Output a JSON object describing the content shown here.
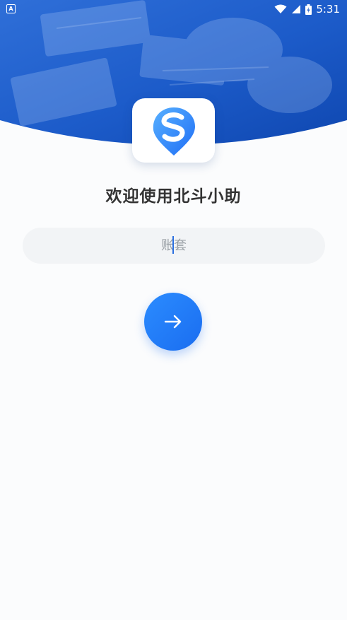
{
  "status_bar": {
    "notification_icon": "a-notification-icon",
    "time": "5:31"
  },
  "app": {
    "logo_icon": "beidou-s-pin-icon",
    "welcome_text": "欢迎使用北斗小助"
  },
  "login": {
    "account_placeholder": "账套",
    "next_icon": "arrow-right-icon"
  },
  "colors": {
    "brand_blue": "#1a6df0",
    "input_bg": "#f2f4f6"
  }
}
